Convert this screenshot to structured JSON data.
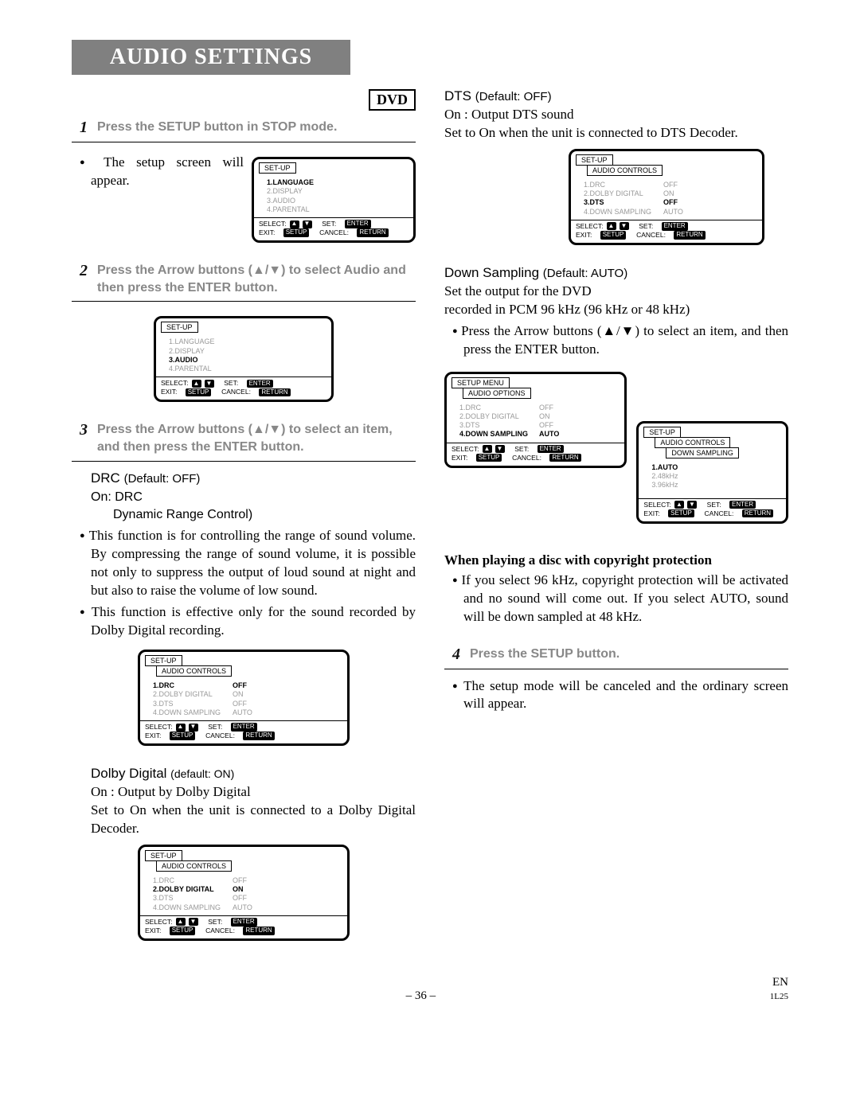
{
  "header": {
    "title": "AUDIO SETTINGS",
    "badge": "DVD"
  },
  "steps": {
    "s1": {
      "num": "1",
      "text": "Press the SETUP button in STOP mode."
    },
    "s1_body": "The setup screen will appear.",
    "s2": {
      "num": "2",
      "text": "Press the Arrow buttons (▲/▼) to select Audio and then press the ENTER button."
    },
    "s3": {
      "num": "3",
      "text": "Press the Arrow buttons (▲/▼) to select an item, and then press the ENTER button."
    },
    "s4": {
      "num": "4",
      "text": "Press the SETUP button."
    },
    "s4_body": "The setup mode will be canceled and the ordinary screen will appear."
  },
  "drc": {
    "title": "DRC",
    "default": "(Default: OFF)",
    "on_line": "On: DRC",
    "sub": "Dynamic Range Control)",
    "p1": "This function is for controlling the range of sound volume. By compressing the range of sound volume, it is possible not only to suppress the output of loud sound at night and but also to raise the volume of low sound.",
    "p2": "This function is effective only for the sound recorded by Dolby Digital recording."
  },
  "dolby": {
    "title": "Dolby Digital",
    "default": "(default: ON)",
    "l1": "On : Output by Dolby Digital",
    "l2": "Set to On when the unit is connected to a Dolby Digital Decoder."
  },
  "dts": {
    "title": "DTS",
    "default": "(Default: OFF)",
    "l1": "On : Output DTS sound",
    "l2": "Set to On when the unit is connected to DTS Decoder."
  },
  "down": {
    "title": "Down Sampling",
    "default": "(Default: AUTO)",
    "l1": "Set the output for the DVD",
    "l2": "recorded in PCM 96 kHz (96 kHz or 48 kHz)",
    "bullet": "Press the Arrow buttons (▲/▼) to select an item, and then press the ENTER button."
  },
  "copyright": {
    "title": "When playing a disc with copyright  protection",
    "p": "If you select 96 kHz, copyright protection will be activated and no sound will come out. If you select AUTO, sound will be down sampled at 48 kHz."
  },
  "osd": {
    "setup": "SET-UP",
    "setup_menu": "SETUP MENU",
    "audio_controls": "AUDIO CONTROLS",
    "audio_options": "AUDIO OPTIONS",
    "down_sampling": "DOWN SAMPLING",
    "menu_main": [
      "1.LANGUAGE",
      "2.DISPLAY",
      "3.AUDIO",
      "4.PARENTAL"
    ],
    "rows": [
      {
        "lab": "1.DRC",
        "val": "OFF"
      },
      {
        "lab": "2.DOLBY DIGITAL",
        "val": "ON"
      },
      {
        "lab": "3.DTS",
        "val": "OFF"
      },
      {
        "lab": "4.DOWN SAMPLING",
        "val": "AUTO"
      }
    ],
    "ds_rows": [
      "1.AUTO",
      "2.48kHz",
      "3.96kHz"
    ],
    "footer": {
      "select": "SELECT:",
      "set": "SET:",
      "exit": "EXIT:",
      "cancel": "CANCEL:",
      "enter": "ENTER",
      "setup_btn": "SETUP",
      "return": "RETURN"
    }
  },
  "footer": {
    "page": "– 36 –",
    "lang": "EN",
    "code": "1L25"
  }
}
